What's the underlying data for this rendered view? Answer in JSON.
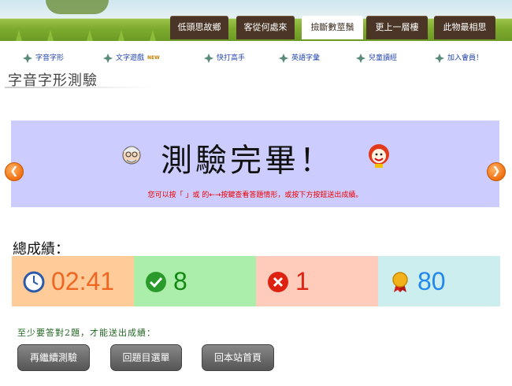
{
  "top_tabs": [
    {
      "label": "低頭思故鄉",
      "active": false
    },
    {
      "label": "客從何處來",
      "active": false
    },
    {
      "label": "撿斷數莖鬚",
      "active": true
    },
    {
      "label": "更上一層樓",
      "active": false
    },
    {
      "label": "此物最相思",
      "active": false
    }
  ],
  "nav": {
    "items": [
      {
        "label": "字音字形",
        "icon": "leaf-icon"
      },
      {
        "label": "文字遊戲",
        "icon": "leaf-icon",
        "badge": "NEW"
      },
      {
        "label": "快打高手",
        "icon": "leaf-icon"
      },
      {
        "label": "英語字彙",
        "icon": "leaf-icon"
      },
      {
        "label": "兒童讀經",
        "icon": "leaf-icon"
      },
      {
        "label": "加入會員！",
        "icon": "leaf-icon"
      }
    ]
  },
  "page_title": "字音字形測驗",
  "banner": {
    "title": "測驗完畢！",
    "hint": "您可以按「 」或 的←→按鍵查看答題情形，或按下方按鈕送出成績。",
    "left_icon": "grandpa-face-icon",
    "right_icon": "clown-face-icon",
    "prev_icon": "arrow-left-icon",
    "next_icon": "arrow-right-icon"
  },
  "score": {
    "label": "總成績：",
    "time": "02:41",
    "correct": "8",
    "wrong": "1",
    "points": "80",
    "colors": {
      "time_bg": "#ffcc99",
      "time_text": "#ee6622",
      "correct_bg": "#aaeeaa",
      "correct_text": "#118811",
      "wrong_bg": "#ffccbb",
      "wrong_text": "#dd2211",
      "points_bg": "#cceeee",
      "points_text": "#2288ee"
    }
  },
  "min_note": "至少要答對2題，才能送出成績：",
  "buttons": {
    "retry": "再繼續測驗",
    "back_to_menu": "回題目選單",
    "home": "回本站首頁"
  }
}
